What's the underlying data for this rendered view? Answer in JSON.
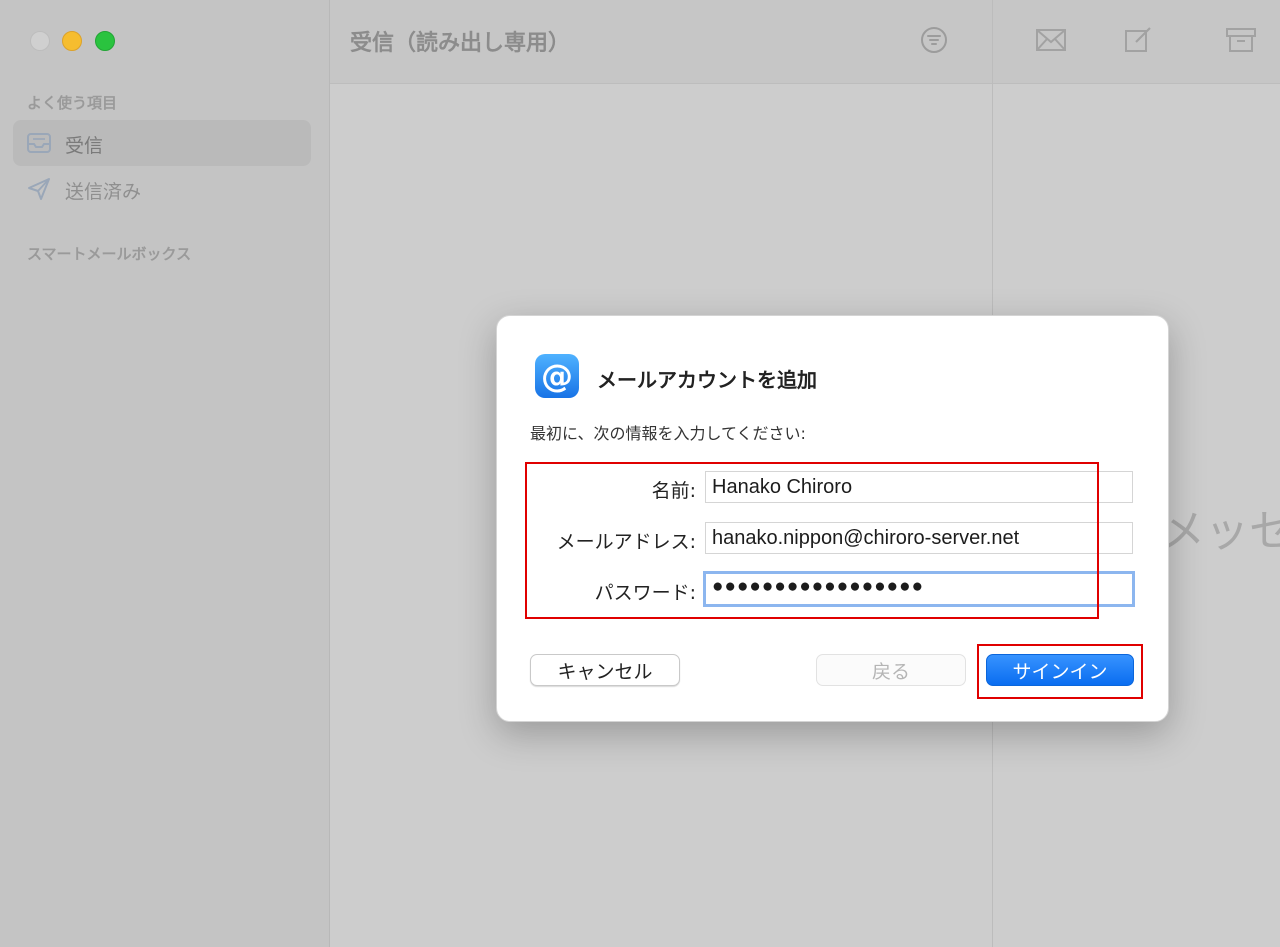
{
  "sidebar": {
    "favorites_header": "よく使う項目",
    "items": [
      {
        "label": "受信",
        "icon": "inbox-icon",
        "selected": true
      },
      {
        "label": "送信済み",
        "icon": "paper-plane-icon",
        "selected": false
      }
    ],
    "smart_mailboxes_header": "スマートメールボックス"
  },
  "list": {
    "title": "受信（読み出し専用）"
  },
  "viewer": {
    "no_message_text": "メッセ"
  },
  "dialog": {
    "title": "メールアカウントを追加",
    "description": "最初に、次の情報を入力してください:",
    "fields": [
      {
        "label": "名前:",
        "value": "Hanako Chiroro"
      },
      {
        "label": "メールアドレス:",
        "value": "hanako.nippon@chiroro-server.net"
      },
      {
        "label": "パスワード:",
        "value": "●●●●●●●●●●●●●●●●●"
      }
    ],
    "buttons": {
      "cancel": "キャンセル",
      "back": "戻る",
      "signin": "サインイン"
    }
  },
  "colors": {
    "accent": "#0a6df0",
    "highlight_box": "#e00000",
    "focus_ring": "#8cb6ef"
  }
}
